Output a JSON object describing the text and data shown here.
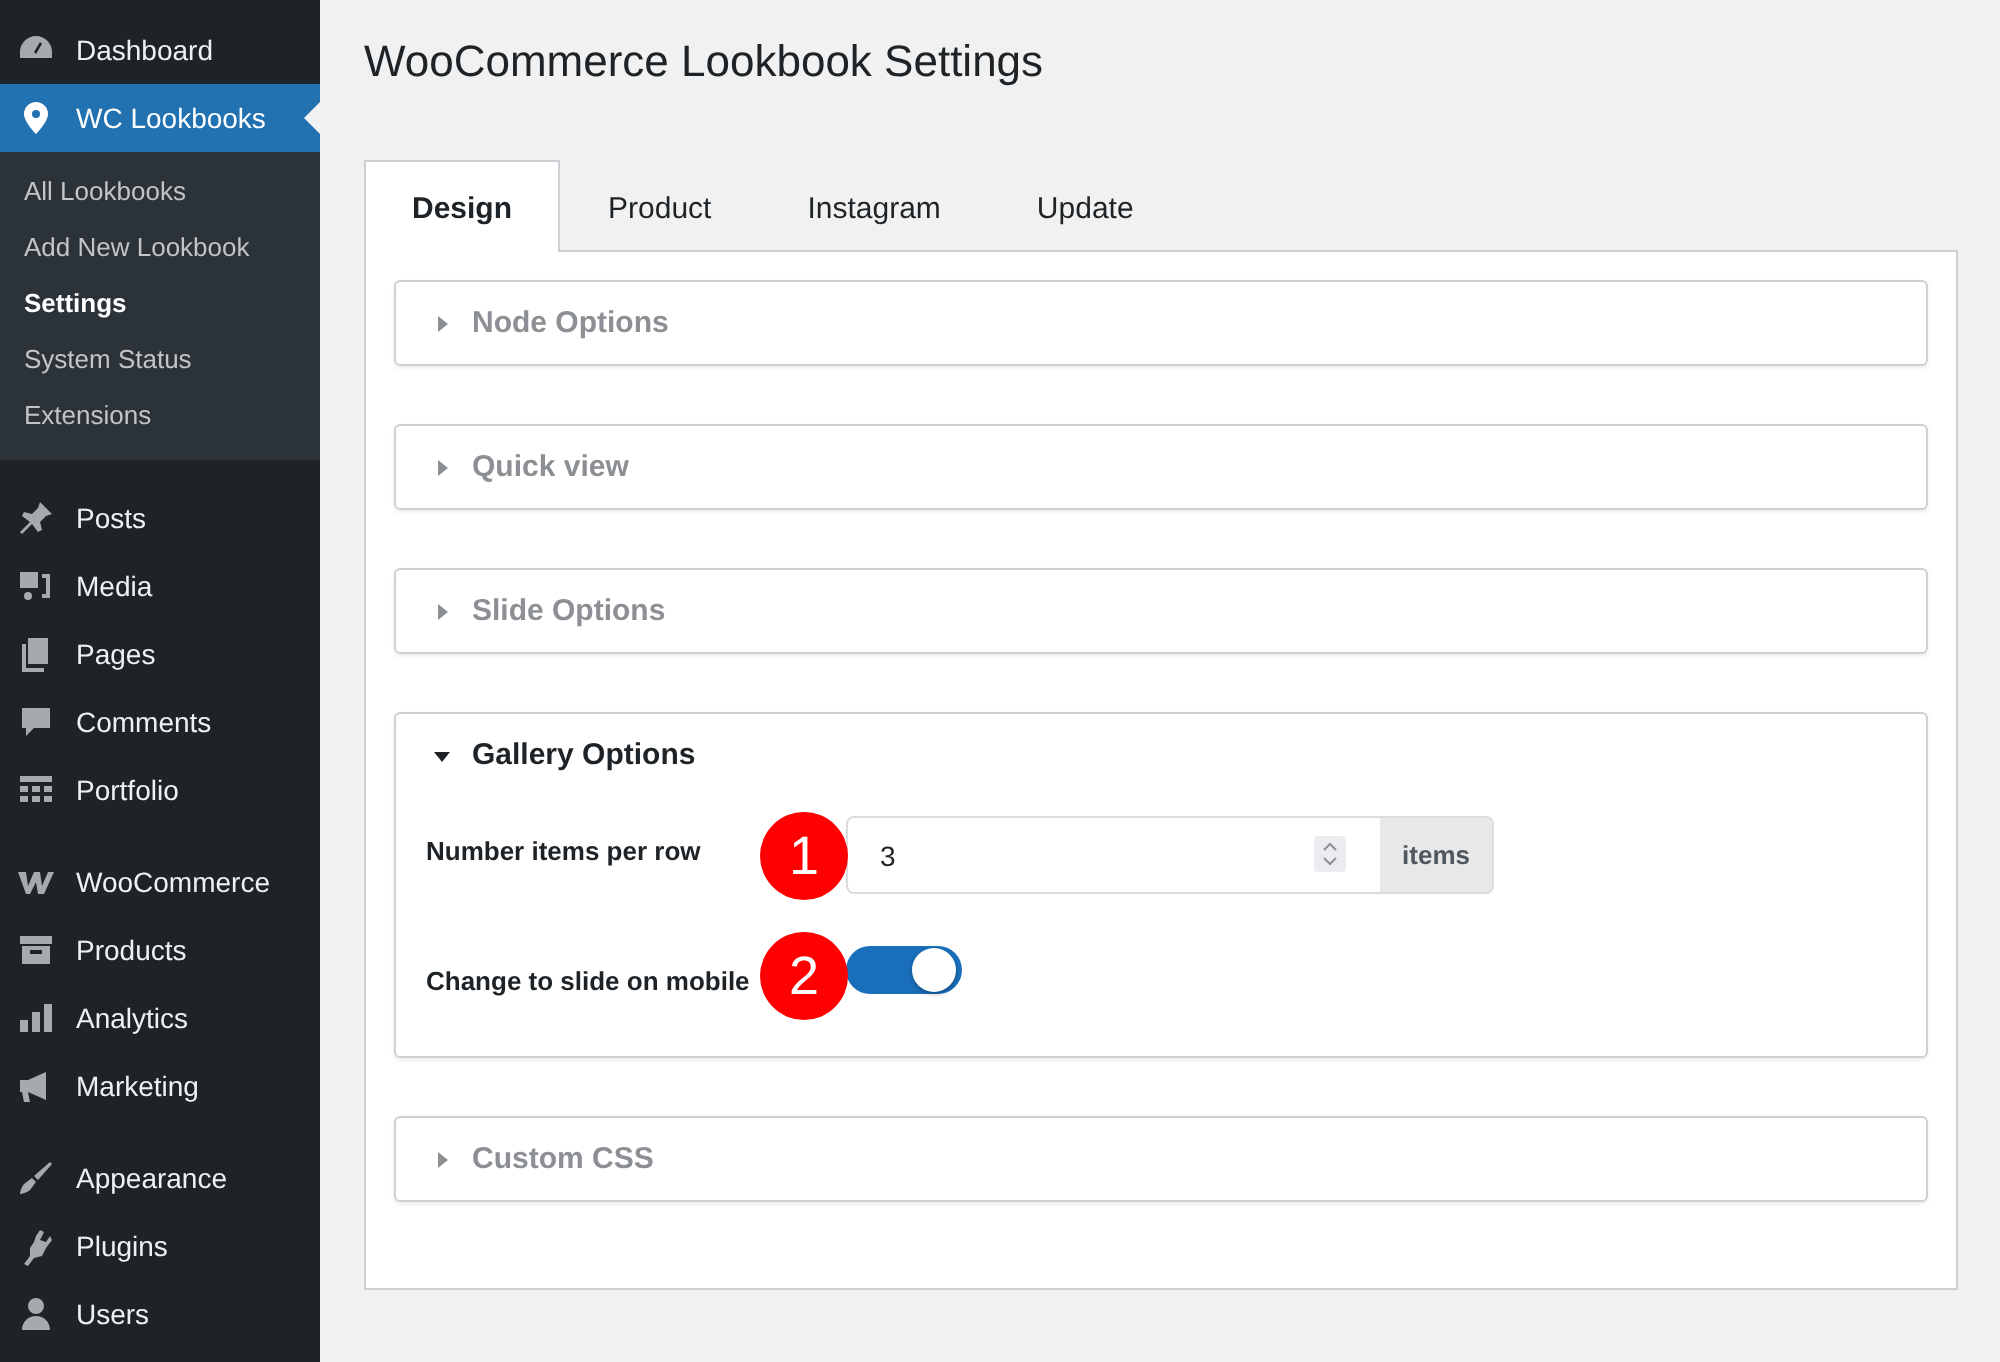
{
  "sidebar": {
    "groups": [
      {
        "items": [
          {
            "label": "Dashboard",
            "selected": false
          },
          {
            "label": "WC Lookbooks",
            "selected": true,
            "children": [
              {
                "label": "All Lookbooks",
                "selected": false
              },
              {
                "label": "Add New Lookbook",
                "selected": false
              },
              {
                "label": "Settings",
                "selected": true
              },
              {
                "label": "System Status",
                "selected": false
              },
              {
                "label": "Extensions",
                "selected": false
              }
            ]
          }
        ]
      },
      {
        "items": [
          {
            "label": "Posts",
            "selected": false
          },
          {
            "label": "Media",
            "selected": false
          },
          {
            "label": "Pages",
            "selected": false
          },
          {
            "label": "Comments",
            "selected": false
          },
          {
            "label": "Portfolio",
            "selected": false
          }
        ]
      },
      {
        "items": [
          {
            "label": "WooCommerce",
            "selected": false
          },
          {
            "label": "Products",
            "selected": false
          },
          {
            "label": "Analytics",
            "selected": false
          },
          {
            "label": "Marketing",
            "selected": false
          }
        ]
      },
      {
        "items": [
          {
            "label": "Appearance",
            "selected": false
          },
          {
            "label": "Plugins",
            "selected": false
          },
          {
            "label": "Users",
            "selected": false
          }
        ]
      }
    ]
  },
  "page": {
    "title": "WooCommerce Lookbook Settings"
  },
  "tabs": [
    {
      "label": "Design",
      "selected": true
    },
    {
      "label": "Product",
      "selected": false
    },
    {
      "label": "Instagram",
      "selected": false
    },
    {
      "label": "Update",
      "selected": false
    }
  ],
  "sections": [
    {
      "title": "Node Options",
      "expanded": false
    },
    {
      "title": "Quick view",
      "expanded": false
    },
    {
      "title": "Slide Options",
      "expanded": false
    },
    {
      "title": "Gallery Options",
      "expanded": true,
      "fields": [
        {
          "kind": "number",
          "label": "Number items per row",
          "value": "3",
          "suffix": "items",
          "marker": "1"
        },
        {
          "kind": "toggle",
          "label": "Change to slide on mobile",
          "on": true,
          "marker": "2"
        }
      ]
    },
    {
      "title": "Custom CSS",
      "expanded": false
    }
  ]
}
